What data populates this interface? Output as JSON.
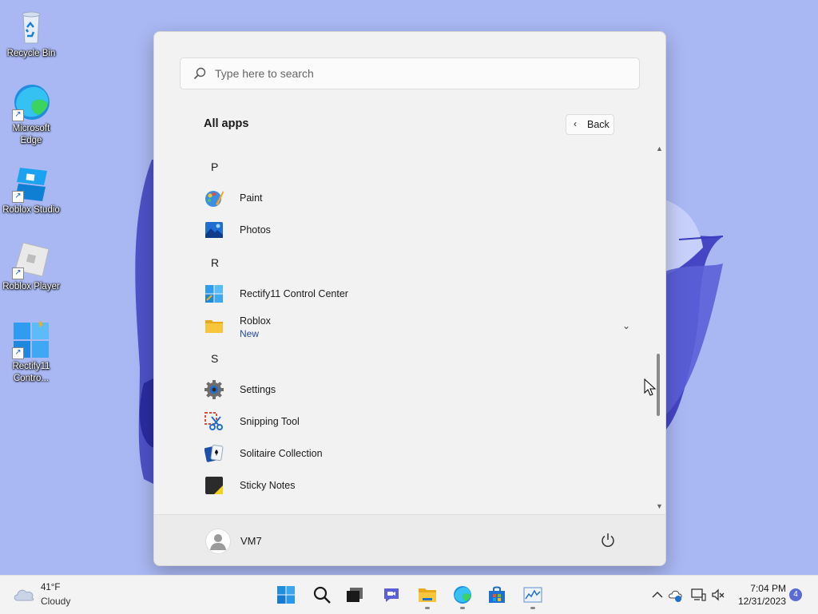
{
  "desktop": {
    "icons": [
      {
        "label": "Recycle Bin",
        "icon": "recycle-bin-icon"
      },
      {
        "label": "Microsoft Edge",
        "icon": "edge-icon"
      },
      {
        "label": "Roblox Studio",
        "icon": "roblox-studio-icon"
      },
      {
        "label": "Roblox Player",
        "icon": "roblox-player-icon"
      },
      {
        "label": "Rectify11 Contro...",
        "icon": "rectify11-icon"
      }
    ]
  },
  "start_menu": {
    "search_placeholder": "Type here to search",
    "title": "All apps",
    "back_label": "Back",
    "sections": [
      {
        "letter": "P",
        "apps": [
          {
            "name": "Paint",
            "icon": "paint-icon"
          },
          {
            "name": "Photos",
            "icon": "photos-icon"
          }
        ]
      },
      {
        "letter": "R",
        "apps": [
          {
            "name": "Rectify11 Control Center",
            "icon": "rectify11-icon"
          },
          {
            "name": "Roblox",
            "sub": "New",
            "icon": "folder-icon",
            "expandable": true
          }
        ]
      },
      {
        "letter": "S",
        "apps": [
          {
            "name": "Settings",
            "icon": "gear-icon"
          },
          {
            "name": "Snipping Tool",
            "icon": "snipping-tool-icon"
          },
          {
            "name": "Solitaire Collection",
            "icon": "solitaire-icon"
          },
          {
            "name": "Sticky Notes",
            "icon": "sticky-notes-icon"
          }
        ]
      }
    ],
    "user": "VM7"
  },
  "taskbar": {
    "weather": {
      "temp": "41°F",
      "condition": "Cloudy"
    },
    "pinned": [
      "start-icon",
      "search-icon",
      "task-view-icon",
      "chat-icon",
      "file-explorer-icon",
      "edge-icon",
      "store-icon",
      "performance-icon"
    ],
    "time": "7:04 PM",
    "date": "12/31/2023",
    "notification_count": "4"
  },
  "colors": {
    "accent": "#0067c0",
    "wallpaper": "#a9b8f3"
  }
}
